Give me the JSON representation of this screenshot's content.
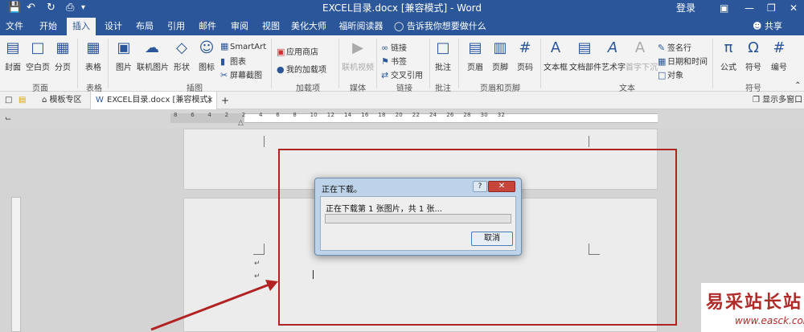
{
  "titlebar": {
    "title": "EXCEL目录.docx [兼容模式] - Word",
    "login": "登录"
  },
  "tabs": [
    "文件",
    "开始",
    "插入",
    "设计",
    "布局",
    "引用",
    "邮件",
    "审阅",
    "视图",
    "美化大师",
    "福昕阅读器"
  ],
  "active_tab": "插入",
  "tell_me": "告诉我你想要做什么",
  "share": "共享",
  "ribbon": {
    "cover": "封面",
    "blank_page": "空白页",
    "page_break": "分页",
    "table": "表格",
    "picture": "图片",
    "online_picture": "联机图片",
    "shapes": "形状",
    "icons": "图标",
    "smartart": "SmartArt",
    "chart": "图表",
    "screenshot": "屏幕截图",
    "app_store": "应用商店",
    "my_addins": "我的加载项",
    "online_video": "联机视频",
    "link": "链接",
    "bookmark": "书签",
    "cross_ref": "交叉引用",
    "comment": "批注",
    "header": "页眉",
    "footer": "页脚",
    "page_number": "页码",
    "textbox": "文本框",
    "doc_parts": "文档部件",
    "wordart": "艺术字",
    "dropcap": "首字下沉",
    "signature_line": "签名行",
    "date_time": "日期和时间",
    "object": "对象",
    "equation": "公式",
    "symbol": "符号",
    "numbering": "编号"
  },
  "groups": [
    "页面",
    "表格",
    "插图",
    "加载项",
    "媒体",
    "链接",
    "批注",
    "页眉和页脚",
    "文本",
    "符号"
  ],
  "doctabs": {
    "template": "模板专区",
    "doc": "EXCEL目录.docx [兼容模式]",
    "close": "×",
    "add": "+",
    "multi_window": "显示多窗口"
  },
  "ruler_marks": [
    "8",
    "6",
    "4",
    "2",
    "2",
    "4",
    "6",
    "8",
    "10",
    "12",
    "14",
    "16",
    "18",
    "20",
    "22",
    "24",
    "26",
    "28",
    "30",
    "32"
  ],
  "dialog": {
    "title": "正在下载。",
    "message": "正在下载第 1 张图片，共 1 张...",
    "cancel": "取消",
    "progress": 0
  },
  "watermark": {
    "big": "易采站长站",
    "small": "www.easck.com"
  },
  "colors": {
    "word_blue": "#2b579a",
    "annotation_red": "#b22222"
  }
}
